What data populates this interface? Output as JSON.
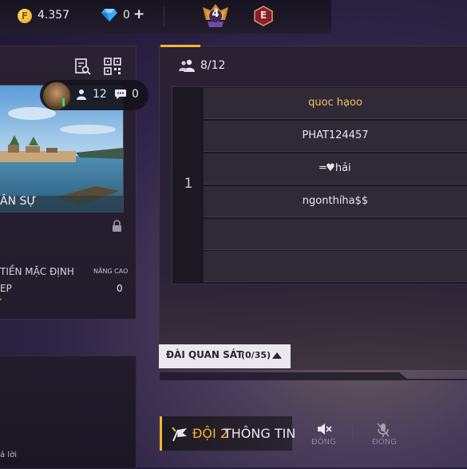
{
  "topbar": {
    "coin_symbol": "F",
    "coin_value": "4.357",
    "diamond_value": "0",
    "plus": "+",
    "rank_number": "4",
    "e_badge_letter": "E"
  },
  "room": {
    "map_name": "ÂN SỰ",
    "player_count": "12",
    "chat_count": "0",
    "label_default": "TIỀN MẶC ĐỊNH",
    "label_advanced": "NÂNG CAO",
    "label_ep": "EP",
    "value_ep": "0",
    "corner_text": "ả lời"
  },
  "team": {
    "count": "8/12",
    "number": "1",
    "slots": [
      "quoc  hạoo",
      "PHAT124457",
      "═♥hải",
      "ngonthíha$$",
      "",
      ""
    ],
    "slot_colors": [
      "#f1c35a",
      "#e8e4ee",
      "#e8e4ee",
      "#e8e4ee",
      "#e8e4ee",
      "#e8e4ee"
    ]
  },
  "observer": {
    "label": "ĐÀI QUAN SÁT",
    "count": "(0/35)"
  },
  "bottom": {
    "team_doi": "ĐỘI 2",
    "team_info": "THÔNG TIN",
    "speaker_label": "ĐÓNG",
    "mic_label": "ĐÓNG"
  },
  "colors": {
    "accent": "#f1b632",
    "slot_bg": "#302a37",
    "panel_bg": "#2a2233"
  },
  "icons": [
    "coin-icon",
    "diamond-icon",
    "rank-badge-icon",
    "e-badge-icon",
    "detail-search-icon",
    "qr-code-icon",
    "person-icon",
    "chat-icon",
    "lock-icon",
    "group-icon",
    "triangle-up-icon",
    "team-flag-icon",
    "speaker-muted-icon",
    "mic-muted-icon"
  ]
}
